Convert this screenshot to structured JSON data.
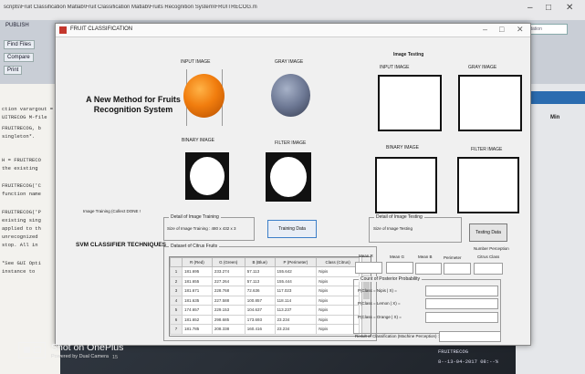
{
  "matlab": {
    "title_path": "scripts\\Fruit Classification Matlab\\Fruit Classification Matlab\\Fruits Recognition System\\FRUITRECOG.m",
    "ribbon_tab": "PUBLISH",
    "ribbon_items": [
      "Find Files",
      "Compare",
      "Print"
    ],
    "search_placeholder": "Search Documentation",
    "min_label": "Min",
    "cmd_lines": [
      "ction varargout = F",
      "UITRECOG M-file",
      "FRUITRECOG, b",
      "singleton*.",
      "H = FRUITRECO",
      "the existing",
      "FRUITRECOG('C",
      "function name",
      "FRUITRECOG('P",
      "existing sing",
      "applied to th",
      "unrecognized",
      "stop.  All in",
      "*See GUI Opti",
      "instance to"
    ],
    "bottom_right_lines": [
      "FRUITRECOG",
      "8--13-04-2017 08:--%"
    ]
  },
  "figure": {
    "title": "FRUIT CLASSIFICATION",
    "heading": "A New Method for Fruits Recognition System",
    "left_labels": {
      "input_image": "INPUT IMAGE",
      "gray_image": "GRAY IMAGE",
      "binary_image": "BINARY IMAGE",
      "filter_image": "FILTER IMAGE",
      "image_training": "Image Training (Collect DONE !",
      "svm": "SVM CLASSIFIER TECHNIQUES"
    },
    "training_group": {
      "title": "Detail of Image Training",
      "size_text": "Size of Image Training : 480 x 432 x 3",
      "button": "Training Data"
    },
    "dataset": {
      "title": "Dataset of Citrus Fruits",
      "columns": [
        "R (Red)",
        "G (Green)",
        "B (Blue)",
        "P (Perimeter)",
        "Class (Citrus)"
      ],
      "rows": [
        [
          "1",
          "181.695",
          "233.274",
          "57.113",
          "155.642",
          "Nipis"
        ],
        [
          "2",
          "181.655",
          "227.264",
          "57.113",
          "155.444",
          "Nipis"
        ],
        [
          "3",
          "181.671",
          "228.768",
          "72.636",
          "117.023",
          "Nipis"
        ],
        [
          "4",
          "181.635",
          "227.588",
          "100.857",
          "118.114",
          "Nipis"
        ],
        [
          "5",
          "174.657",
          "229.153",
          "104.637",
          "113.237",
          "Nipis"
        ],
        [
          "6",
          "181.652",
          "298.685",
          "173.693",
          "23.234",
          "Nipis"
        ],
        [
          "7",
          "181.785",
          "208.338",
          "160.416",
          "23.234",
          "Nipis"
        ]
      ]
    },
    "testing": {
      "header": "Image Testing",
      "input_image": "INPUT IMAGE",
      "gray_image": "GRAY IMAGE",
      "binary_image": "BINARY IMAGE",
      "filter_image": "FILTER IMAGE",
      "group_title": "Detail of Image Testing",
      "size_text": "Size of Image Testing",
      "button": "Testing Data",
      "number_perception": "Number Perception",
      "mean_labels": [
        "Mean R",
        "Mean G",
        "Mean B",
        "Perimeter",
        "Citrus Class"
      ],
      "prob_group_title": "Count of Posterior Probability",
      "prob_labels": [
        "P(Class = Nipis | X) =",
        "P(Class = Lemon | X) =",
        "P(Class = Orange | X) ="
      ],
      "result_label": "Result of Classification (Machine Perception) :"
    }
  },
  "photo_mark": {
    "title": "Shot on OnePlus",
    "subtitle": "Powered by Dual Camera",
    "page_num": "15"
  },
  "colors": {
    "fruit_orange": "#f17d0e",
    "fruit_gray": "#6d7894",
    "focus_blue": "#3c7fc8"
  }
}
